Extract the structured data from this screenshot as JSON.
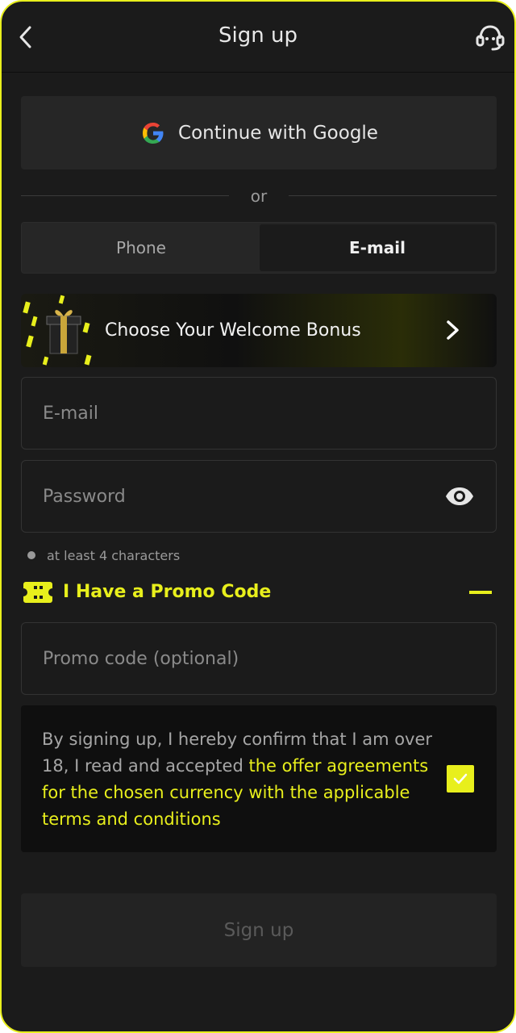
{
  "header": {
    "title": "Sign up",
    "back_icon": "chevron-left-icon",
    "support_icon": "headset-support-icon"
  },
  "google": {
    "label": "Continue with Google",
    "icon": "google-g-icon"
  },
  "divider": {
    "text": "or"
  },
  "tabs": [
    {
      "label": "Phone",
      "active": false
    },
    {
      "label": "E-mail",
      "active": true
    }
  ],
  "bonus": {
    "label": "Choose Your Welcome Bonus",
    "icon": "gift-box-icon"
  },
  "email_field": {
    "placeholder": "E-mail",
    "value": ""
  },
  "password_field": {
    "placeholder": "Password",
    "value": "",
    "icon": "eye-icon"
  },
  "password_hint": "at least 4 characters",
  "promo": {
    "title": "I Have a Promo Code",
    "icon": "ticket-icon",
    "expanded": true,
    "placeholder": "Promo code (optional)",
    "value": ""
  },
  "terms": {
    "text": "By signing up, I hereby confirm that I am over 18, I read and accepted ",
    "link": "the offer agreements for the chosen currency with the applicable terms and conditions",
    "checked": true
  },
  "submit": {
    "label": "Sign up",
    "enabled": false
  },
  "colors": {
    "accent": "#e8ef1c",
    "background": "#1b1b1b",
    "surface": "#262626",
    "text_primary": "#e6e6e6",
    "text_muted": "#8a8a8a"
  }
}
